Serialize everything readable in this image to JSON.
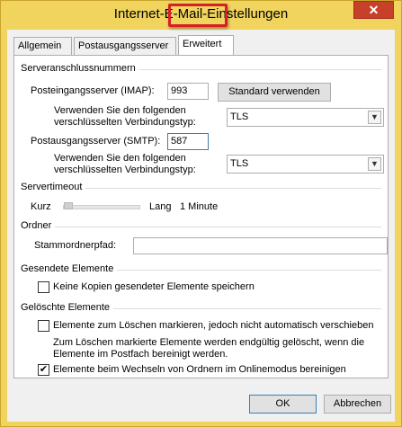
{
  "window": {
    "title": "Internet-E-Mail-Einstellungen",
    "close_glyph": "✕"
  },
  "tabs": [
    {
      "label": "Allgemein"
    },
    {
      "label": "Postausgangsserver"
    },
    {
      "label": "Erweitert",
      "active": true
    }
  ],
  "server_ports": {
    "heading": "Serveranschlussnummern",
    "incoming_label": "Posteingangsserver (IMAP):",
    "incoming_value": "993",
    "default_button": "Standard verwenden",
    "enc_label_line1": "Verwenden Sie den folgenden",
    "enc_label_line2": "verschlüsselten Verbindungstyp:",
    "incoming_encryption": "TLS",
    "outgoing_label": "Postausgangsserver (SMTP):",
    "outgoing_value": "587",
    "outgoing_encryption": "TLS"
  },
  "timeout": {
    "heading": "Servertimeout",
    "short_label": "Kurz",
    "long_label": "Lang",
    "value": "1 Minute",
    "slider_level": 0.02
  },
  "folders": {
    "heading": "Ordner",
    "root_label": "Stammordnerpfad:",
    "root_value": ""
  },
  "sent_items": {
    "heading": "Gesendete Elemente",
    "no_copies_label": "Keine Kopien gesendeter Elemente speichern",
    "no_copies_checked": false
  },
  "deleted_items": {
    "heading": "Gelöschte Elemente",
    "mark_label": "Elemente zum Löschen markieren, jedoch nicht automatisch verschieben",
    "mark_checked": false,
    "info_line1": "Zum Löschen markierte Elemente werden endgültig gelöscht, wenn die",
    "info_line2": "Elemente im Postfach bereinigt werden.",
    "purge_label": "Elemente beim Wechseln von Ordnern im Onlinemodus bereinigen",
    "purge_checked": true,
    "check_glyph": "✔"
  },
  "footer": {
    "ok_label": "OK",
    "cancel_label": "Abbrechen"
  }
}
